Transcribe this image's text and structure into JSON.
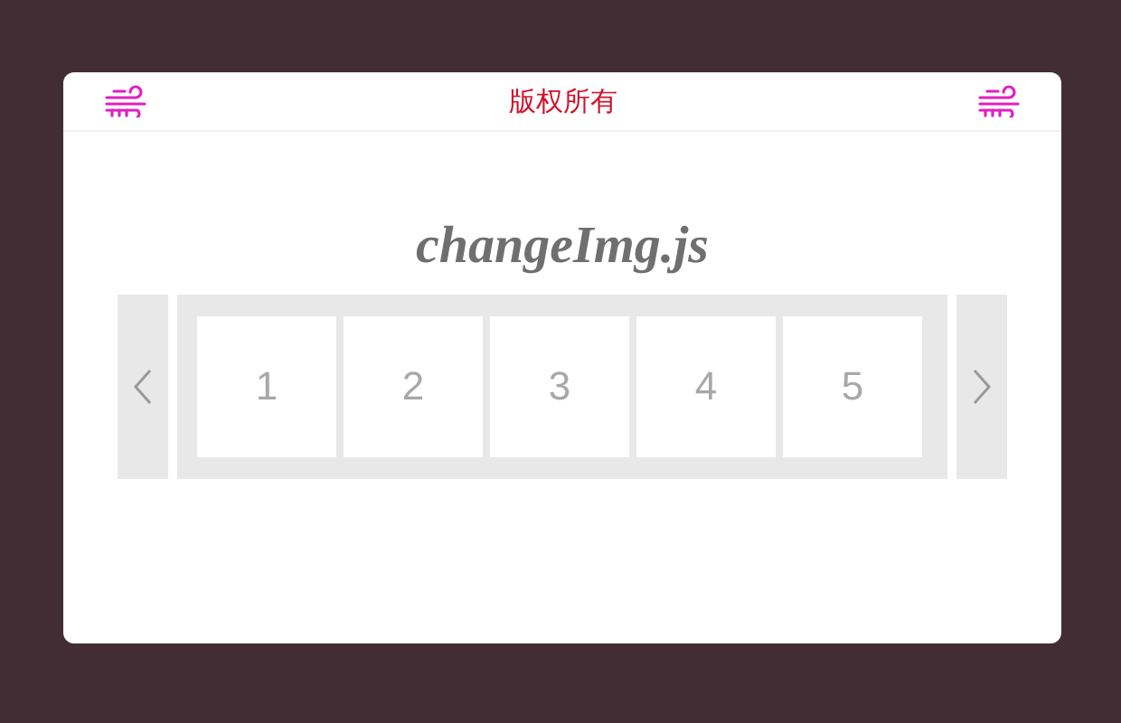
{
  "header": {
    "title": "版权所有"
  },
  "heading": "changeImg.js",
  "carousel": {
    "slides": [
      {
        "label": "1"
      },
      {
        "label": "2"
      },
      {
        "label": "3"
      },
      {
        "label": "4"
      },
      {
        "label": "5"
      }
    ]
  }
}
